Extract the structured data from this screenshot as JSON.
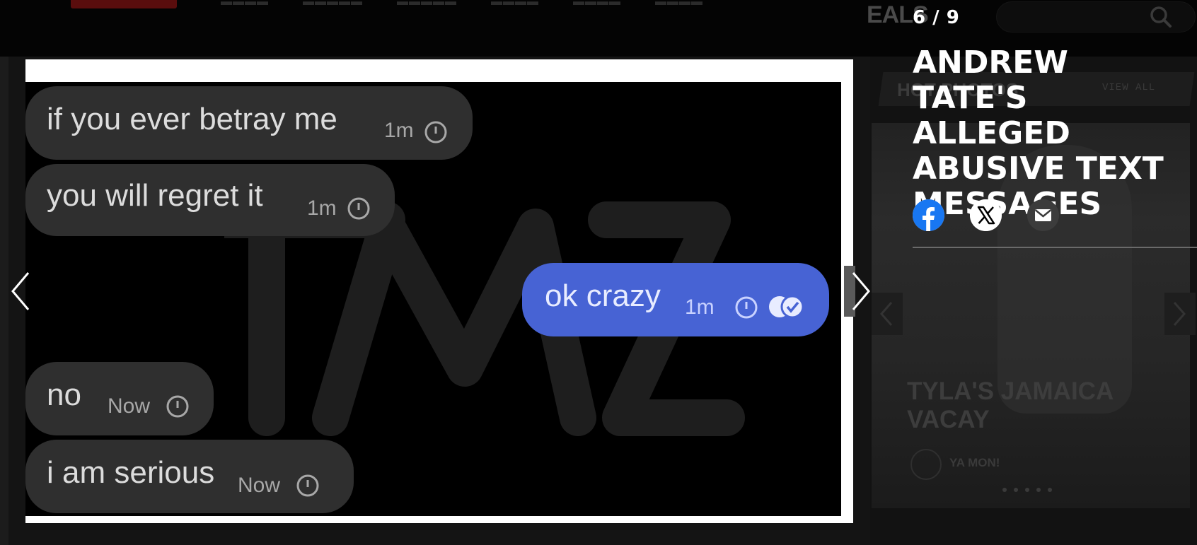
{
  "background": {
    "nav_deals_fragment": "EALS",
    "hot_photos_title": "HOT PHOTOS",
    "view_all_label": "VIEW ALL",
    "promo_title": "TYLA'S JAMAICA VACAY",
    "promo_subtitle": "YA MON!"
  },
  "gallery": {
    "counter": "6 / 9",
    "title": "ANDREW TATE'S ALLEGED ABUSIVE TEXT MESSAGES",
    "current_index": 6,
    "total": 9
  },
  "messages": [
    {
      "direction": "incoming",
      "text": "if you ever betray me",
      "time": "1m"
    },
    {
      "direction": "incoming",
      "text": "you will regret it",
      "time": "1m"
    },
    {
      "direction": "outgoing",
      "text": "ok crazy",
      "time": "1m"
    },
    {
      "direction": "incoming",
      "text": "no",
      "time": "Now"
    },
    {
      "direction": "incoming",
      "text": "i am serious",
      "time": "Now"
    }
  ],
  "watermark": "TMZ",
  "share": {
    "facebook_icon": "facebook-icon",
    "x_icon": "x-twitter-icon",
    "email_icon": "email-icon"
  },
  "colors": {
    "outgoing_bubble": "#4763d4",
    "incoming_bubble": "#2f2f2f",
    "facebook_blue": "#1877f2",
    "page_bg": "#0a0a0a"
  }
}
